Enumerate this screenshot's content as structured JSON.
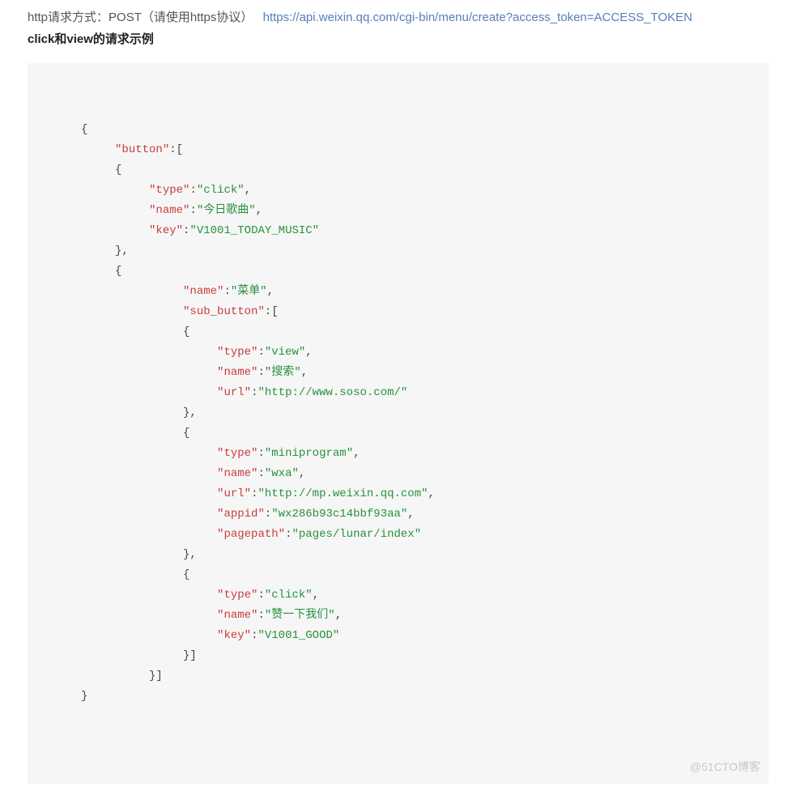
{
  "intro": {
    "prefix": "http请求方式：POST（请使用https协议）",
    "url": "https://api.weixin.qq.com/cgi-bin/menu/create?access_token=ACCESS_TOKEN"
  },
  "subtitle": "click和view的请求示例",
  "code": {
    "lines": [
      {
        "indent": 1,
        "parts": [
          {
            "t": "p",
            "v": "{"
          }
        ]
      },
      {
        "indent": 2,
        "parts": [
          {
            "t": "k",
            "v": "\"button\""
          },
          {
            "t": "p",
            "v": ":["
          }
        ]
      },
      {
        "indent": 2,
        "parts": [
          {
            "t": "p",
            "v": "{\t"
          }
        ]
      },
      {
        "indent": 3,
        "parts": [
          {
            "t": "k",
            "v": "\"type\""
          },
          {
            "t": "p",
            "v": ":"
          },
          {
            "t": "s",
            "v": "\"click\""
          },
          {
            "t": "p",
            "v": ","
          }
        ]
      },
      {
        "indent": 3,
        "parts": [
          {
            "t": "k",
            "v": "\"name\""
          },
          {
            "t": "p",
            "v": ":"
          },
          {
            "t": "s",
            "v": "\"今日歌曲\""
          },
          {
            "t": "p",
            "v": ","
          }
        ]
      },
      {
        "indent": 3,
        "parts": [
          {
            "t": "k",
            "v": "\"key\""
          },
          {
            "t": "p",
            "v": ":"
          },
          {
            "t": "s",
            "v": "\"V1001_TODAY_MUSIC\""
          }
        ]
      },
      {
        "indent": 2,
        "parts": [
          {
            "t": "p",
            "v": "},"
          }
        ]
      },
      {
        "indent": 2,
        "parts": [
          {
            "t": "p",
            "v": "{"
          }
        ]
      },
      {
        "indent": 4,
        "parts": [
          {
            "t": "k",
            "v": "\"name\""
          },
          {
            "t": "p",
            "v": ":"
          },
          {
            "t": "s",
            "v": "\"菜单\""
          },
          {
            "t": "p",
            "v": ","
          }
        ]
      },
      {
        "indent": 4,
        "parts": [
          {
            "t": "k",
            "v": "\"sub_button\""
          },
          {
            "t": "p",
            "v": ":["
          }
        ]
      },
      {
        "indent": 4,
        "parts": [
          {
            "t": "p",
            "v": "{\t"
          }
        ]
      },
      {
        "indent": 5,
        "parts": [
          {
            "t": "k",
            "v": "\"type\""
          },
          {
            "t": "p",
            "v": ":"
          },
          {
            "t": "s",
            "v": "\"view\""
          },
          {
            "t": "p",
            "v": ","
          }
        ]
      },
      {
        "indent": 5,
        "parts": [
          {
            "t": "k",
            "v": "\"name\""
          },
          {
            "t": "p",
            "v": ":"
          },
          {
            "t": "s",
            "v": "\"搜索\""
          },
          {
            "t": "p",
            "v": ","
          }
        ]
      },
      {
        "indent": 5,
        "parts": [
          {
            "t": "k",
            "v": "\"url\""
          },
          {
            "t": "p",
            "v": ":"
          },
          {
            "t": "s",
            "v": "\"http://www.soso.com/\""
          }
        ]
      },
      {
        "indent": 4,
        "parts": [
          {
            "t": "p",
            "v": "},"
          }
        ]
      },
      {
        "indent": 4,
        "parts": [
          {
            "t": "p",
            "v": "{"
          }
        ]
      },
      {
        "indent": 5,
        "parts": [
          {
            "t": "k",
            "v": "\"type\""
          },
          {
            "t": "p",
            "v": ":"
          },
          {
            "t": "s",
            "v": "\"miniprogram\""
          },
          {
            "t": "p",
            "v": ","
          }
        ]
      },
      {
        "indent": 5,
        "parts": [
          {
            "t": "k",
            "v": "\"name\""
          },
          {
            "t": "p",
            "v": ":"
          },
          {
            "t": "s",
            "v": "\"wxa\""
          },
          {
            "t": "p",
            "v": ","
          }
        ]
      },
      {
        "indent": 5,
        "parts": [
          {
            "t": "k",
            "v": "\"url\""
          },
          {
            "t": "p",
            "v": ":"
          },
          {
            "t": "s",
            "v": "\"http://mp.weixin.qq.com\""
          },
          {
            "t": "p",
            "v": ","
          }
        ]
      },
      {
        "indent": 5,
        "parts": [
          {
            "t": "k",
            "v": "\"appid\""
          },
          {
            "t": "p",
            "v": ":"
          },
          {
            "t": "s",
            "v": "\"wx286b93c14bbf93aa\""
          },
          {
            "t": "p",
            "v": ","
          }
        ]
      },
      {
        "indent": 5,
        "parts": [
          {
            "t": "k",
            "v": "\"pagepath\""
          },
          {
            "t": "p",
            "v": ":"
          },
          {
            "t": "s",
            "v": "\"pages/lunar/index\""
          }
        ]
      },
      {
        "indent": 4,
        "parts": [
          {
            "t": "p",
            "v": "},"
          }
        ]
      },
      {
        "indent": 4,
        "parts": [
          {
            "t": "p",
            "v": "{"
          }
        ]
      },
      {
        "indent": 5,
        "parts": [
          {
            "t": "k",
            "v": "\"type\""
          },
          {
            "t": "p",
            "v": ":"
          },
          {
            "t": "s",
            "v": "\"click\""
          },
          {
            "t": "p",
            "v": ","
          }
        ]
      },
      {
        "indent": 5,
        "parts": [
          {
            "t": "k",
            "v": "\"name\""
          },
          {
            "t": "p",
            "v": ":"
          },
          {
            "t": "s",
            "v": "\"赞一下我们\""
          },
          {
            "t": "p",
            "v": ","
          }
        ]
      },
      {
        "indent": 5,
        "parts": [
          {
            "t": "k",
            "v": "\"key\""
          },
          {
            "t": "p",
            "v": ":"
          },
          {
            "t": "s",
            "v": "\"V1001_GOOD\""
          }
        ]
      },
      {
        "indent": 4,
        "parts": [
          {
            "t": "p",
            "v": "}]"
          }
        ]
      },
      {
        "indent": 3,
        "parts": [
          {
            "t": "p",
            "v": "}]"
          }
        ]
      },
      {
        "indent": 1,
        "parts": [
          {
            "t": "p",
            "v": "}"
          }
        ]
      }
    ]
  },
  "watermark": "@51CTO博客"
}
